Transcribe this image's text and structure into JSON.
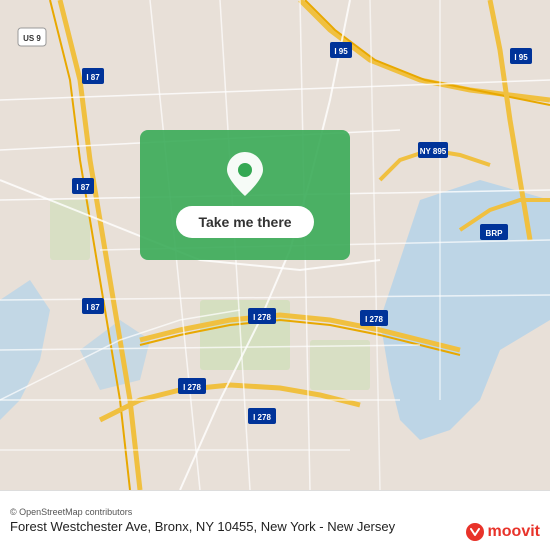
{
  "map": {
    "background_color": "#e8e0d8",
    "alt": "Map of Bronx, NY area"
  },
  "panel": {
    "button_label": "Take me there",
    "pin_icon": "location-pin"
  },
  "footer": {
    "osm_credit": "© OpenStreetMap contributors",
    "address": "Forest Westchester Ave, Bronx, NY 10455, New York - New Jersey"
  },
  "branding": {
    "logo_text": "moovit"
  }
}
